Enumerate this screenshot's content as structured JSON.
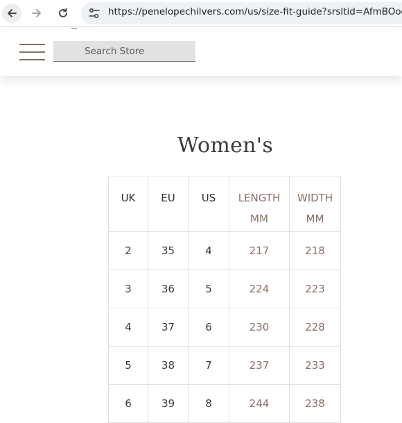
{
  "browser": {
    "url": "https://penelopechilvers.com/us/size-fit-guide?srsltid=AfmBOoqCJ"
  },
  "header": {
    "search_placeholder": "Search Store"
  },
  "page": {
    "title": "Women's"
  },
  "size_table": {
    "headers": [
      {
        "line1": "UK",
        "line2": ""
      },
      {
        "line1": "EU",
        "line2": ""
      },
      {
        "line1": "US",
        "line2": ""
      },
      {
        "line1": "LENGTH",
        "line2": "MM"
      },
      {
        "line1": "WIDTH",
        "line2": "MM"
      }
    ],
    "rows": [
      [
        "2",
        "35",
        "4",
        "217",
        "218"
      ],
      [
        "3",
        "36",
        "5",
        "224",
        "223"
      ],
      [
        "4",
        "37",
        "6",
        "230",
        "228"
      ],
      [
        "5",
        "38",
        "7",
        "237",
        "233"
      ],
      [
        "6",
        "39",
        "8",
        "244",
        "238"
      ]
    ]
  },
  "colors": {
    "accent": "#8a6f63",
    "search_bg": "#e2e2e2",
    "browser_bar": "#eef1f5"
  },
  "icons": {
    "back": "arrow-left-icon",
    "forward": "arrow-right-icon",
    "reload": "reload-icon",
    "site_info": "tune-icon",
    "menu": "hamburger-icon"
  }
}
